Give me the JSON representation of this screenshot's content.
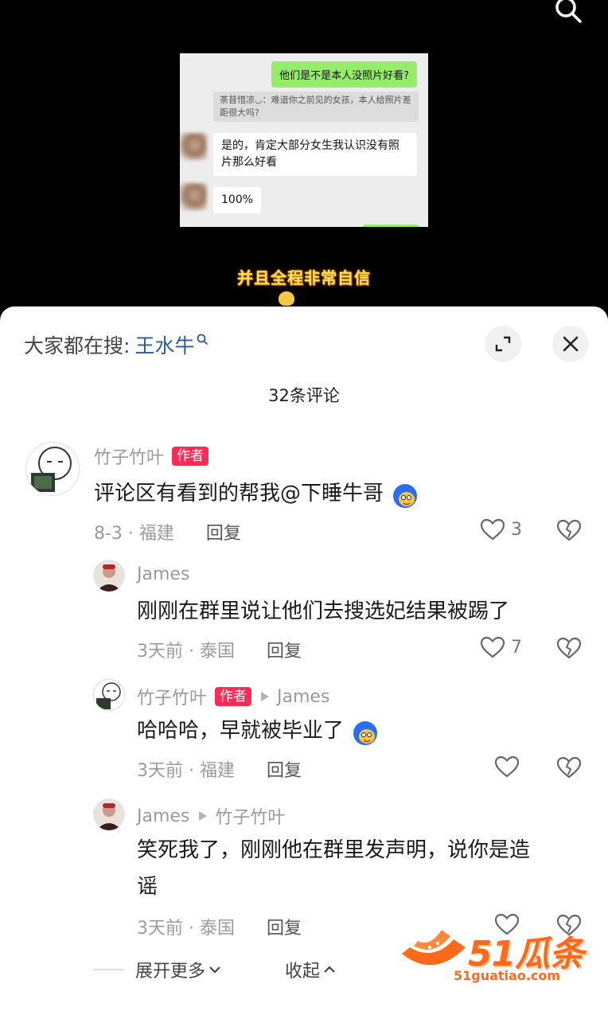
{
  "video": {
    "chat": {
      "my_message": "他们是不是本人没照片好看?",
      "quoted": "茶苜惜凉◡：难道你之前见的女孩，本人给照片差距很大吗?",
      "reply1": "是的，肯定大部分女生我认识没有照片那么好看",
      "reply2": "100%"
    },
    "overlay_caption": "并且全程非常自信"
  },
  "sheet": {
    "hot_search_prefix": "大家都在搜:",
    "hot_search_term": "王水牛",
    "comment_count_label": "32条评论"
  },
  "comments": [
    {
      "name": "竹子竹叶",
      "badge": "作者",
      "text": "评论区有看到的帮我@下睡牛哥",
      "meta": "8-3 · 福建",
      "reply": "回复",
      "likes": "3"
    },
    {
      "name": "James",
      "text": "刚刚在群里说让他们去搜选妃结果被踢了",
      "meta": "3天前 · 泰国",
      "reply": "回复",
      "likes": "7"
    },
    {
      "name": "竹子竹叶",
      "badge": "作者",
      "reply_to": "James",
      "text": "哈哈哈，早就被毕业了",
      "meta": "3天前 · 福建",
      "reply": "回复",
      "likes": ""
    },
    {
      "name": "James",
      "reply_to": "竹子竹叶",
      "text_line1": "笑死我了，刚刚他在群里发声明，说你是造",
      "text_line2": "谣",
      "meta": "3天前 · 泰国",
      "reply": "回复",
      "likes": ""
    }
  ],
  "footer": {
    "expand_more": "展开更多",
    "collapse": "收起"
  },
  "watermark": {
    "brand": "51瓜条",
    "url": "51guatiao.com"
  },
  "colors": {
    "accent": "#fe2c55",
    "link": "#2b5c9c",
    "wechat_green": "#95ec69",
    "watermark": "#ff6a1a"
  }
}
